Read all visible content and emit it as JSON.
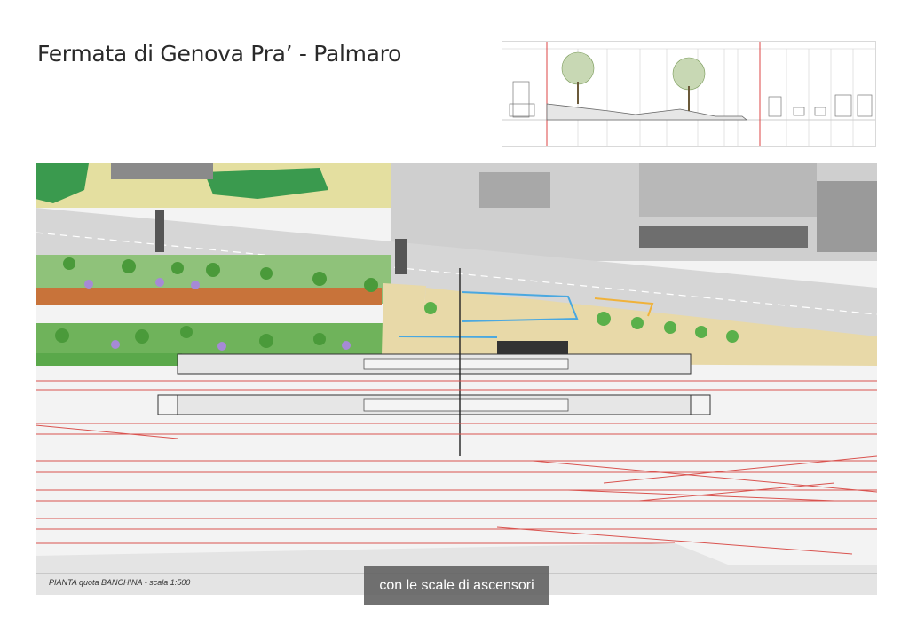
{
  "slide": {
    "title": "Fermata di Genova Pra’ - Palmaro"
  },
  "plan": {
    "caption": "PIANTA quota BANCHINA - scala 1:500"
  },
  "subtitle": {
    "text": "con le scale di ascensori"
  },
  "colors": {
    "track_red": "#d9534f",
    "green_area": "#2f9a4a",
    "sand": "#e8d9a8",
    "brick": "#c8733a",
    "accent_blue": "#4aa8e0"
  }
}
